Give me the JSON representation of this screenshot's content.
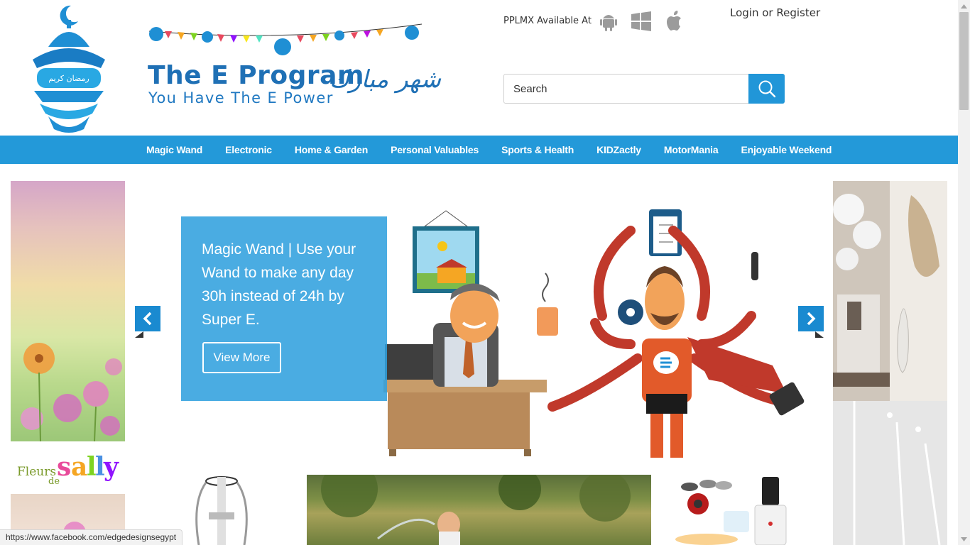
{
  "header": {
    "brand_title": "The E Program",
    "brand_tagline": "You Have The E Power",
    "brand_arabic": "شهر مبارك",
    "lantern_text": "رمضان كريم",
    "available_label": "PPLMX Available At",
    "platform_icons": [
      "android-icon",
      "windows-icon",
      "apple-icon"
    ],
    "login_label": "Login",
    "login_separator": "or",
    "register_label": "Register"
  },
  "search": {
    "placeholder": "Search",
    "button_icon": "search-icon"
  },
  "nav": {
    "items": [
      {
        "label": "Magic Wand"
      },
      {
        "label": "Electronic"
      },
      {
        "label": "Home & Garden"
      },
      {
        "label": "Personal Valuables"
      },
      {
        "label": "Sports & Health"
      },
      {
        "label": "KIDZactly"
      },
      {
        "label": "MotorMania"
      },
      {
        "label": "Enjoyable Weekend"
      }
    ]
  },
  "slider": {
    "caption": "Magic Wand | Use your Wand to make any day 30h instead of 24h by Super E.",
    "cta_label": "View More",
    "prev_icon": "chevron-left-icon",
    "next_icon": "chevron-right-icon"
  },
  "ads": {
    "left_logo": "Fleurs de Sally"
  },
  "statusbar": {
    "url": "https://www.facebook.com/edgedesignsegypt"
  },
  "colors": {
    "primary": "#2399d9",
    "brand_blue": "#1f70b5",
    "caption_bg": "#31a0de"
  }
}
